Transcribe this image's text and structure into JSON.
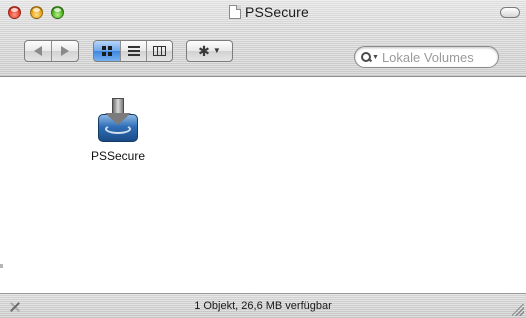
{
  "window": {
    "title": "PSSecure"
  },
  "toolbar": {
    "back_icon": "back-arrow-icon",
    "forward_icon": "forward-arrow-icon",
    "views": [
      {
        "name": "icon-view",
        "icon": "grid-icon",
        "active": true
      },
      {
        "name": "list-view",
        "icon": "list-icon",
        "active": false
      },
      {
        "name": "column-view",
        "icon": "columns-icon",
        "active": false
      }
    ],
    "action_icon": "gear-icon"
  },
  "search": {
    "placeholder": "Lokale Volumes"
  },
  "files": [
    {
      "label": "PSSecure",
      "icon": "installer-package-icon"
    }
  ],
  "status": {
    "text": "1 Objekt, 26,6 MB verfügbar"
  },
  "colors": {
    "active_view": "#4a8fe3",
    "close": "#e8402a",
    "minimize": "#e9a617",
    "maximize": "#4fb221"
  }
}
